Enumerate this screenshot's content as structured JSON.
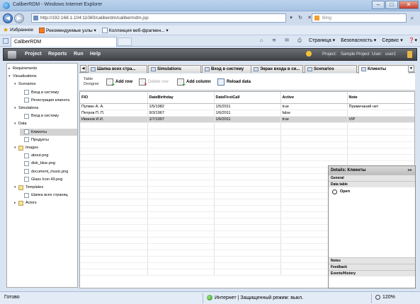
{
  "window": {
    "title": "CaliberRDM - Windows Internet Explorer",
    "minimize": "–",
    "maximize": "□",
    "close": "✕"
  },
  "addressbar": {
    "back": "◀",
    "forward": "▶",
    "url": "http://192.168.1.104:11080/caliberdm/calibermdm.jsp",
    "search_placeholder": "Bing",
    "search_icon": "⌕",
    "tools": [
      "▾",
      "↻",
      "✕"
    ]
  },
  "favorites_bar": {
    "favorites_label": "Избранное",
    "suggested_sites": "Рекомендуемые узлы ▾",
    "web_slice_gallery": "Коллекция веб-фрагмен... ▾"
  },
  "browser_tab": {
    "label": "CaliberRDM"
  },
  "command_bar": {
    "page": "Страница ▾",
    "safety": "Безопасность ▾",
    "service": "Сервис ▾",
    "help": "❓▾"
  },
  "app": {
    "menu": [
      "Project",
      "Reports",
      "Run",
      "Help"
    ],
    "project_label": "Project:",
    "project_value": "Sample Project",
    "user_label": "User:",
    "user_value": "user1"
  },
  "tree": [
    {
      "label": "Requirements",
      "level": 0,
      "expander": "▸",
      "icon": "grid"
    },
    {
      "label": "Visualizations",
      "level": 0,
      "expander": "▾",
      "icon": "grid"
    },
    {
      "label": "Scenarios",
      "level": 1,
      "expander": "▾",
      "icon": "grid"
    },
    {
      "label": "Вход в систему",
      "level": 2,
      "expander": "",
      "icon": "doc"
    },
    {
      "label": "Регистрация клиента",
      "level": 2,
      "expander": "",
      "icon": "doc"
    },
    {
      "label": "Simulations",
      "level": 1,
      "expander": "▾",
      "icon": "grid"
    },
    {
      "label": "Вход в систему",
      "level": 2,
      "expander": "",
      "icon": "doc"
    },
    {
      "label": "Data",
      "level": 1,
      "expander": "▾",
      "icon": "grid"
    },
    {
      "label": "Клиенты",
      "level": 2,
      "expander": "",
      "icon": "doc",
      "selected": true
    },
    {
      "label": "Продукты",
      "level": 2,
      "expander": "",
      "icon": "doc"
    },
    {
      "label": "Images",
      "level": 1,
      "expander": "▾",
      "icon": "folder"
    },
    {
      "label": "about.png",
      "level": 2,
      "expander": "",
      "icon": "doc"
    },
    {
      "label": "disk_blue.png",
      "level": 2,
      "expander": "",
      "icon": "doc"
    },
    {
      "label": "document_music.png",
      "level": 2,
      "expander": "",
      "icon": "doc"
    },
    {
      "label": "Glass Icon 49.png",
      "level": 2,
      "expander": "",
      "icon": "doc"
    },
    {
      "label": "Templates",
      "level": 1,
      "expander": "▾",
      "icon": "folder"
    },
    {
      "label": "Шапка всех страниц",
      "level": 2,
      "expander": "",
      "icon": "doc"
    },
    {
      "label": "Actors",
      "level": 1,
      "expander": "▸",
      "icon": "folder"
    }
  ],
  "editor_tabs": {
    "scroll_left": "◀",
    "menu": "▼",
    "tabs": [
      {
        "label": "Шапка всех стра..."
      },
      {
        "label": "Simulations"
      },
      {
        "label": "Вход в систему"
      },
      {
        "label": "Экран входа в си..."
      },
      {
        "label": "Scenarios"
      },
      {
        "label": "Клиенты",
        "active": true
      }
    ]
  },
  "toolbar": {
    "title": "Table\nDesigner",
    "add_row": "Add row",
    "delete_row": "Delete row",
    "add_column": "Add column",
    "reload_data": "Reload data"
  },
  "table": {
    "columns": [
      "FIO",
      "DateBirthday",
      "DateFirstCall",
      "Active",
      "Note"
    ],
    "rows": [
      [
        "Пупкин А. А.",
        "1/5/1982",
        "1/5/2011",
        "true",
        "Примечаний нет"
      ],
      [
        "Петров П. П.",
        "9/3/1967",
        "1/6/2011",
        "false",
        ""
      ],
      [
        "Иванов И.И.",
        "1/7/1997",
        "1/6/2011",
        "true",
        "VIP"
      ]
    ]
  },
  "details": {
    "title": "Details: Клиенты",
    "pin": "▸▸",
    "general": "General",
    "data_table": "Data table",
    "open": "Open",
    "notes": "Notes",
    "feedback": "Feedback",
    "events": "Events/History"
  },
  "statusbar": {
    "ready": "Готово",
    "zone": "Интернет | Защищенный режим: выкл.",
    "zoom": "120%"
  },
  "colors": {
    "app_menu_bg": "#4f5257",
    "selection": "#d3d3d3",
    "ie_chrome": "#cddbed"
  }
}
